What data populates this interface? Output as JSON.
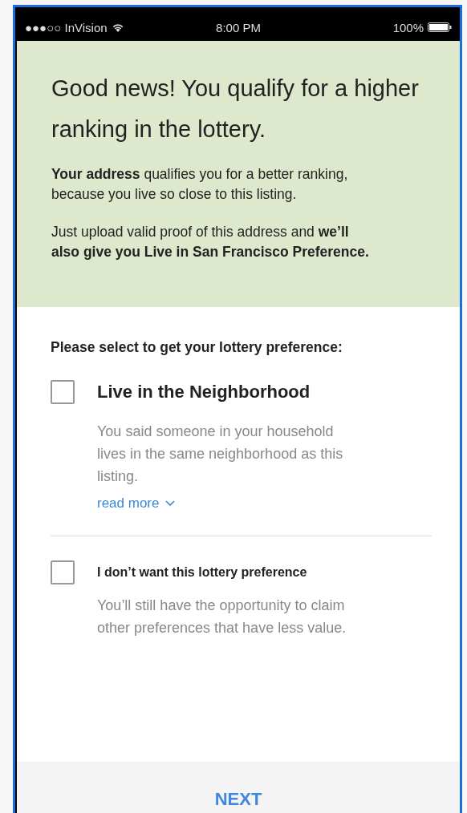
{
  "status_bar": {
    "carrier": "●●●○○ InVision",
    "time": "8:00 PM",
    "battery": "100%"
  },
  "banner": {
    "heading": "Good news! You qualify for a higher ranking in the lottery.",
    "paragraphs": [
      "**Your address** qualifies you for a better ranking, because you live so close to this listing.",
      "Just upload valid proof of this address and **we’ll also give you Live in San Francisco Preference.**"
    ]
  },
  "prompt": "Please select to get your lottery preference:",
  "options": [
    {
      "kind": "preference",
      "title": "Live in the Neighborhood",
      "checked": false,
      "description": "You said someone in your household lives in the same neighborhood as this listing.",
      "link": "read more"
    },
    {
      "kind": "decline",
      "title": "I don’t want this lottery preference",
      "checked": false,
      "description": "You’ll still have the opportunity to claim other preferences that have less value."
    }
  ],
  "footer_button": "NEXT"
}
